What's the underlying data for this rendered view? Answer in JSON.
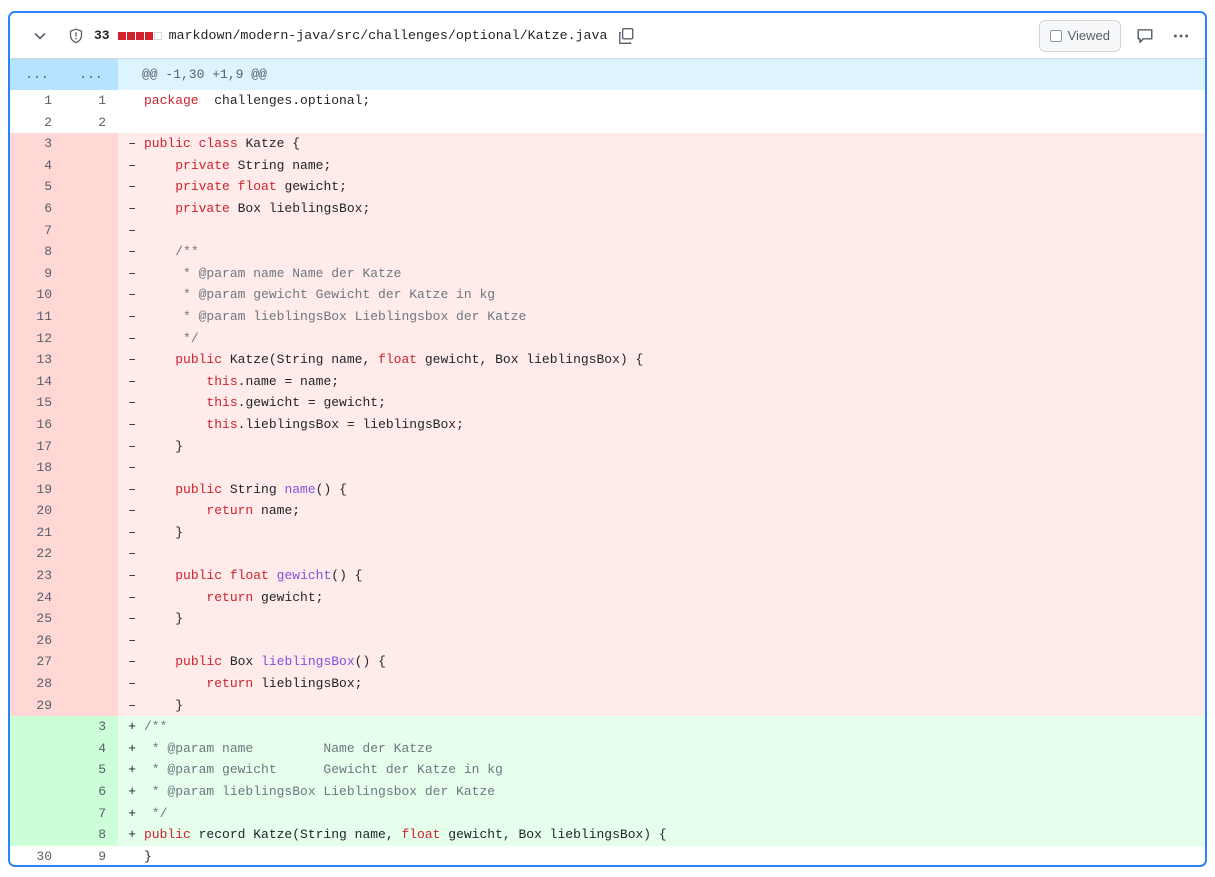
{
  "header": {
    "count": "33",
    "path": "markdown/modern-java/src/challenges/optional/Katze.java",
    "viewed_label": "Viewed",
    "diffstat": [
      "del",
      "del",
      "del",
      "del",
      "neu"
    ]
  },
  "hunk": {
    "left": "...",
    "right": "...",
    "text": "@@ -1,30 +1,9 @@"
  },
  "lines": [
    {
      "t": "ctx",
      "l": "1",
      "r": "1",
      "s": "",
      "tokens": [
        [
          "kw",
          "package"
        ],
        [
          "",
          "  challenges.optional;"
        ]
      ]
    },
    {
      "t": "ctx",
      "l": "2",
      "r": "2",
      "s": "",
      "tokens": []
    },
    {
      "t": "del",
      "l": "3",
      "r": "",
      "s": "–",
      "tokens": [
        [
          "kw",
          "public"
        ],
        [
          "",
          " "
        ],
        [
          "kw",
          "class"
        ],
        [
          "",
          " Katze {"
        ]
      ]
    },
    {
      "t": "del",
      "l": "4",
      "r": "",
      "s": "–",
      "tokens": [
        [
          "",
          "    "
        ],
        [
          "kw",
          "private"
        ],
        [
          "",
          " String name;"
        ]
      ]
    },
    {
      "t": "del",
      "l": "5",
      "r": "",
      "s": "–",
      "tokens": [
        [
          "",
          "    "
        ],
        [
          "kw",
          "private"
        ],
        [
          "",
          " "
        ],
        [
          "kw",
          "float"
        ],
        [
          "",
          " gewicht;"
        ]
      ]
    },
    {
      "t": "del",
      "l": "6",
      "r": "",
      "s": "–",
      "tokens": [
        [
          "",
          "    "
        ],
        [
          "kw",
          "private"
        ],
        [
          "",
          " Box lieblingsBox;"
        ]
      ]
    },
    {
      "t": "del",
      "l": "7",
      "r": "",
      "s": "–",
      "tokens": []
    },
    {
      "t": "del",
      "l": "8",
      "r": "",
      "s": "–",
      "tokens": [
        [
          "",
          "    "
        ],
        [
          "cm",
          "/**"
        ]
      ]
    },
    {
      "t": "del",
      "l": "9",
      "r": "",
      "s": "–",
      "tokens": [
        [
          "",
          "     "
        ],
        [
          "cm",
          "* @param name Name der Katze"
        ]
      ]
    },
    {
      "t": "del",
      "l": "10",
      "r": "",
      "s": "–",
      "tokens": [
        [
          "",
          "     "
        ],
        [
          "cm",
          "* @param gewicht Gewicht der Katze in kg"
        ]
      ]
    },
    {
      "t": "del",
      "l": "11",
      "r": "",
      "s": "–",
      "tokens": [
        [
          "",
          "     "
        ],
        [
          "cm",
          "* @param lieblingsBox Lieblingsbox der Katze"
        ]
      ]
    },
    {
      "t": "del",
      "l": "12",
      "r": "",
      "s": "–",
      "tokens": [
        [
          "",
          "     "
        ],
        [
          "cm",
          "*/"
        ]
      ]
    },
    {
      "t": "del",
      "l": "13",
      "r": "",
      "s": "–",
      "tokens": [
        [
          "",
          "    "
        ],
        [
          "kw",
          "public"
        ],
        [
          "",
          " Katze(String name, "
        ],
        [
          "kw",
          "float"
        ],
        [
          "",
          " gewicht, Box lieblingsBox) {"
        ]
      ]
    },
    {
      "t": "del",
      "l": "14",
      "r": "",
      "s": "–",
      "tokens": [
        [
          "",
          "        "
        ],
        [
          "kw",
          "this"
        ],
        [
          "",
          ".name = name;"
        ]
      ]
    },
    {
      "t": "del",
      "l": "15",
      "r": "",
      "s": "–",
      "tokens": [
        [
          "",
          "        "
        ],
        [
          "kw",
          "this"
        ],
        [
          "",
          ".gewicht = gewicht;"
        ]
      ]
    },
    {
      "t": "del",
      "l": "16",
      "r": "",
      "s": "–",
      "tokens": [
        [
          "",
          "        "
        ],
        [
          "kw",
          "this"
        ],
        [
          "",
          ".lieblingsBox = lieblingsBox;"
        ]
      ]
    },
    {
      "t": "del",
      "l": "17",
      "r": "",
      "s": "–",
      "tokens": [
        [
          "",
          "    }"
        ]
      ]
    },
    {
      "t": "del",
      "l": "18",
      "r": "",
      "s": "–",
      "tokens": []
    },
    {
      "t": "del",
      "l": "19",
      "r": "",
      "s": "–",
      "tokens": [
        [
          "",
          "    "
        ],
        [
          "kw",
          "public"
        ],
        [
          "",
          " String "
        ],
        [
          "fn",
          "name"
        ],
        [
          "",
          "() {"
        ]
      ]
    },
    {
      "t": "del",
      "l": "20",
      "r": "",
      "s": "–",
      "tokens": [
        [
          "",
          "        "
        ],
        [
          "kw",
          "return"
        ],
        [
          "",
          " name;"
        ]
      ]
    },
    {
      "t": "del",
      "l": "21",
      "r": "",
      "s": "–",
      "tokens": [
        [
          "",
          "    }"
        ]
      ]
    },
    {
      "t": "del",
      "l": "22",
      "r": "",
      "s": "–",
      "tokens": []
    },
    {
      "t": "del",
      "l": "23",
      "r": "",
      "s": "–",
      "tokens": [
        [
          "",
          "    "
        ],
        [
          "kw",
          "public"
        ],
        [
          "",
          " "
        ],
        [
          "kw",
          "float"
        ],
        [
          "",
          " "
        ],
        [
          "fn",
          "gewicht"
        ],
        [
          "",
          "() {"
        ]
      ]
    },
    {
      "t": "del",
      "l": "24",
      "r": "",
      "s": "–",
      "tokens": [
        [
          "",
          "        "
        ],
        [
          "kw",
          "return"
        ],
        [
          "",
          " gewicht;"
        ]
      ]
    },
    {
      "t": "del",
      "l": "25",
      "r": "",
      "s": "–",
      "tokens": [
        [
          "",
          "    }"
        ]
      ]
    },
    {
      "t": "del",
      "l": "26",
      "r": "",
      "s": "–",
      "tokens": []
    },
    {
      "t": "del",
      "l": "27",
      "r": "",
      "s": "–",
      "tokens": [
        [
          "",
          "    "
        ],
        [
          "kw",
          "public"
        ],
        [
          "",
          " Box "
        ],
        [
          "fn",
          "lieblingsBox"
        ],
        [
          "",
          "() {"
        ]
      ]
    },
    {
      "t": "del",
      "l": "28",
      "r": "",
      "s": "–",
      "tokens": [
        [
          "",
          "        "
        ],
        [
          "kw",
          "return"
        ],
        [
          "",
          " lieblingsBox;"
        ]
      ]
    },
    {
      "t": "del",
      "l": "29",
      "r": "",
      "s": "–",
      "tokens": [
        [
          "",
          "    }"
        ]
      ]
    },
    {
      "t": "add",
      "l": "",
      "r": "3",
      "s": "+",
      "tokens": [
        [
          "cm",
          "/**"
        ]
      ]
    },
    {
      "t": "add",
      "l": "",
      "r": "4",
      "s": "+",
      "tokens": [
        [
          "cm",
          " * @param name         Name der Katze"
        ]
      ]
    },
    {
      "t": "add",
      "l": "",
      "r": "5",
      "s": "+",
      "tokens": [
        [
          "cm",
          " * @param gewicht      Gewicht der Katze in kg"
        ]
      ]
    },
    {
      "t": "add",
      "l": "",
      "r": "6",
      "s": "+",
      "tokens": [
        [
          "cm",
          " * @param lieblingsBox Lieblingsbox der Katze"
        ]
      ]
    },
    {
      "t": "add",
      "l": "",
      "r": "7",
      "s": "+",
      "tokens": [
        [
          "cm",
          " */"
        ]
      ]
    },
    {
      "t": "add",
      "l": "",
      "r": "8",
      "s": "+",
      "tokens": [
        [
          "kw",
          "public"
        ],
        [
          "",
          " record Katze(String name, "
        ],
        [
          "kw",
          "float"
        ],
        [
          "",
          " gewicht, Box lieblingsBox) {"
        ]
      ]
    },
    {
      "t": "ctx",
      "l": "30",
      "r": "9",
      "s": "",
      "tokens": [
        [
          "",
          "}"
        ]
      ]
    }
  ]
}
